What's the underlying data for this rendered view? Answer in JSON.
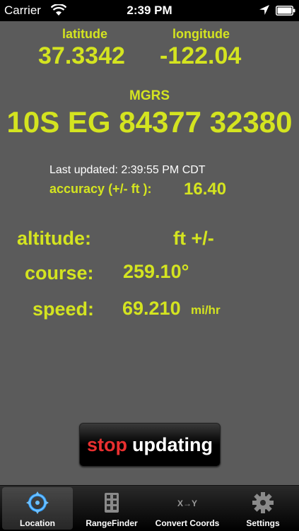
{
  "status_bar": {
    "carrier": "Carrier",
    "time": "2:39 PM"
  },
  "location": {
    "latitude_label": "latitude",
    "longitude_label": "longitude",
    "latitude": "37.3342",
    "longitude": "-122.04",
    "mgrs_label": "MGRS",
    "mgrs": "10S EG 84377 32380",
    "last_updated": "Last updated:  2:39:55 PM CDT",
    "accuracy_label": "accuracy (+/- ft ):",
    "accuracy": "16.40",
    "altitude_label": "altitude:",
    "altitude_unit": "ft +/-",
    "course_label": "course:",
    "course": "259.10°",
    "speed_label": "speed:",
    "speed": "69.210",
    "speed_unit": "mi/hr"
  },
  "button": {
    "word1": "stop",
    "word2": "updating"
  },
  "tabs": [
    {
      "label": "Location",
      "icon": "location-target-icon"
    },
    {
      "label": "RangeFinder",
      "icon": "rangefinder-icon"
    },
    {
      "label": "Convert Coords",
      "icon": "convert-coords-icon",
      "icon_text": "X→Y"
    },
    {
      "label": "Settings",
      "icon": "gear-icon"
    }
  ],
  "colors": {
    "accent": "#d4e420",
    "background": "#5b5b5b",
    "stop": "#e83030"
  }
}
